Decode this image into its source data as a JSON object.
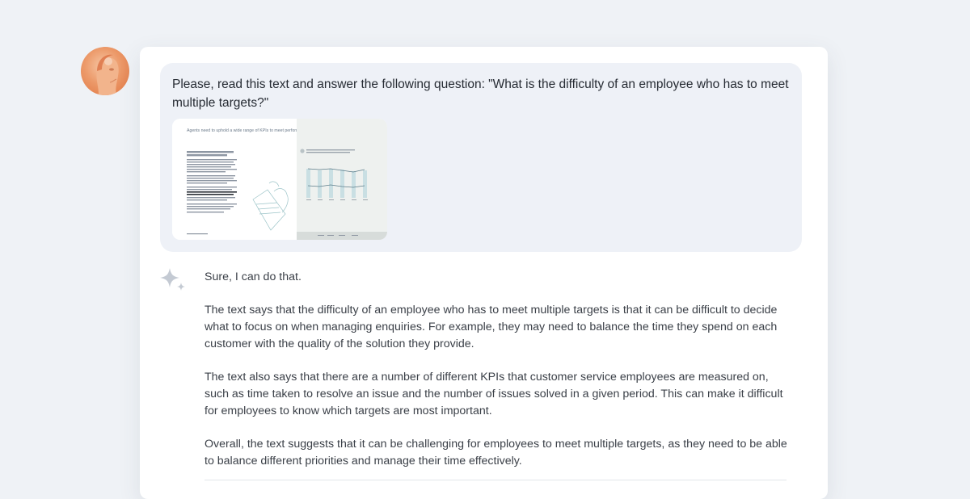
{
  "prompt": {
    "text": "Please, read this text and answer the following question: \"What is the difficulty of an employee who has to meet multiple targets?\"",
    "attachment": {
      "page_heading": "Agents need to uphold a wide range of KPIs to meet performance targets"
    }
  },
  "response": {
    "paragraphs": [
      "Sure, I can do that.",
      "The text says that the difficulty of an employee who has to meet multiple targets is that it can be difficult to decide what to focus on when managing enquiries. For example, they may need to balance the time they spend on each customer with the quality of the solution they provide.",
      "The text also says that there are a number of different KPIs that customer service employees are measured on, such as time taken to resolve an issue and the number of issues solved in a given period. This can make it difficult for employees to know which targets are most important.",
      "Overall, the text suggests that it can be challenging for employees to meet multiple targets, as they need to be able to balance different priorities and manage their time effectively."
    ]
  },
  "icons": {
    "avatar": "user-avatar",
    "assistant": "sparkle-icon"
  }
}
